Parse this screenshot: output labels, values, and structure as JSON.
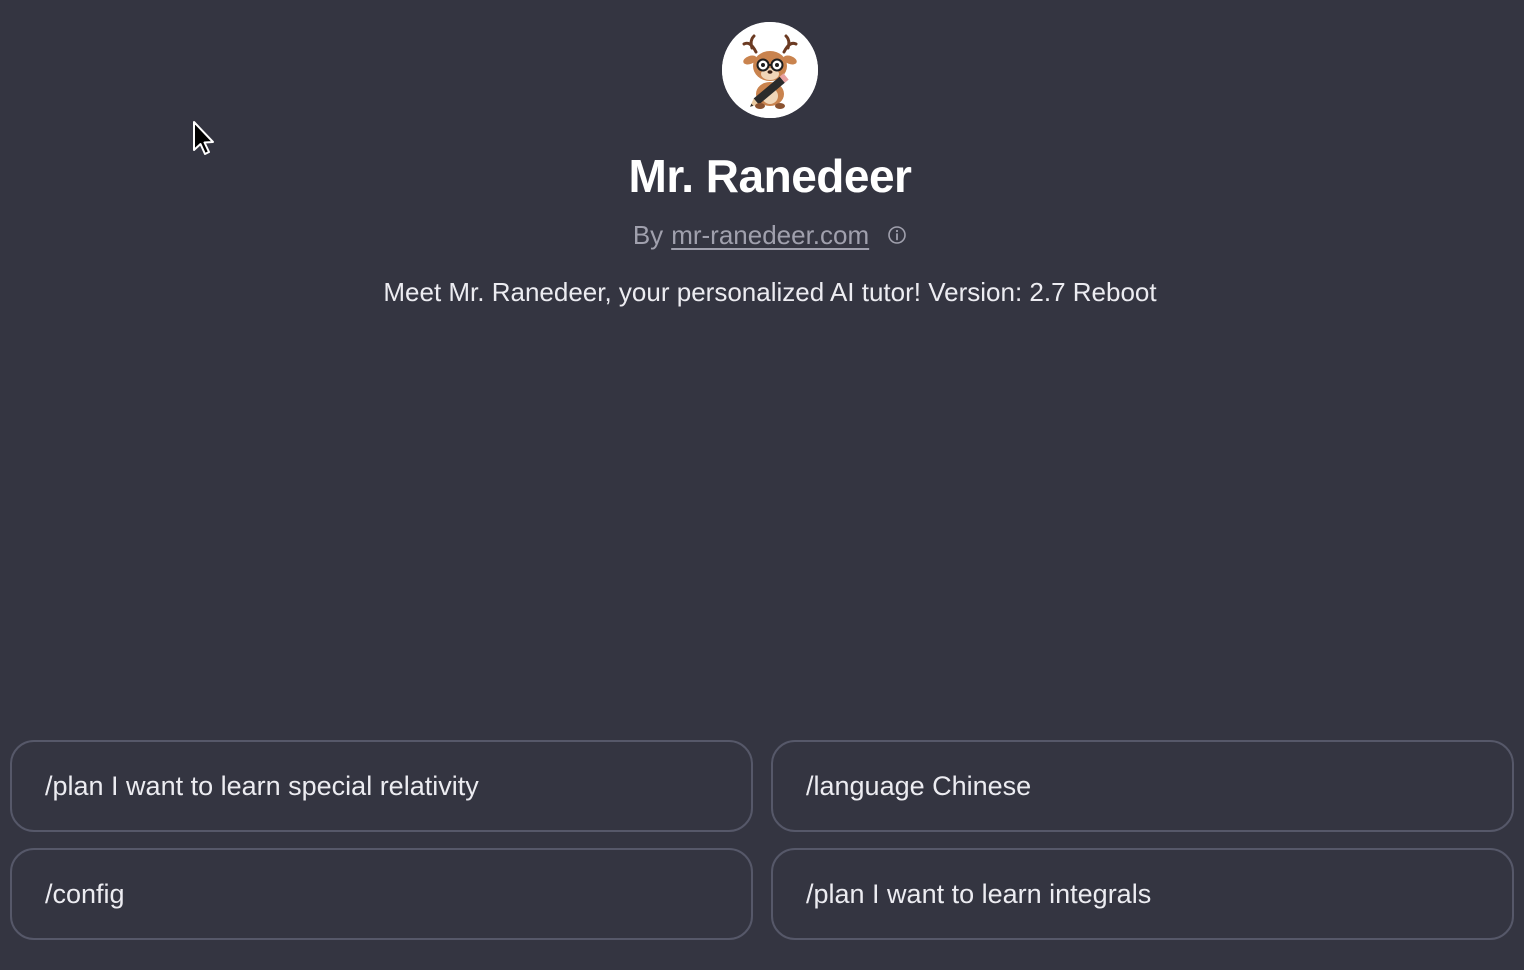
{
  "app": {
    "name": "Mr. Ranedeer",
    "byline_prefix": "By",
    "author_link": "mr-ranedeer.com",
    "description": "Meet Mr. Ranedeer, your personalized AI tutor! Version: 2.7 Reboot"
  },
  "avatar": {
    "icon": "deer-with-glasses-and-pencil-icon"
  },
  "suggestions": [
    {
      "label": "/plan I want to learn special relativity"
    },
    {
      "label": "/language Chinese"
    },
    {
      "label": "/config"
    },
    {
      "label": "/plan I want to learn integrals"
    }
  ],
  "colors": {
    "background": "#343541",
    "title": "#ffffff",
    "muted_text": "#a0a0ad",
    "card_border": "#565869"
  }
}
